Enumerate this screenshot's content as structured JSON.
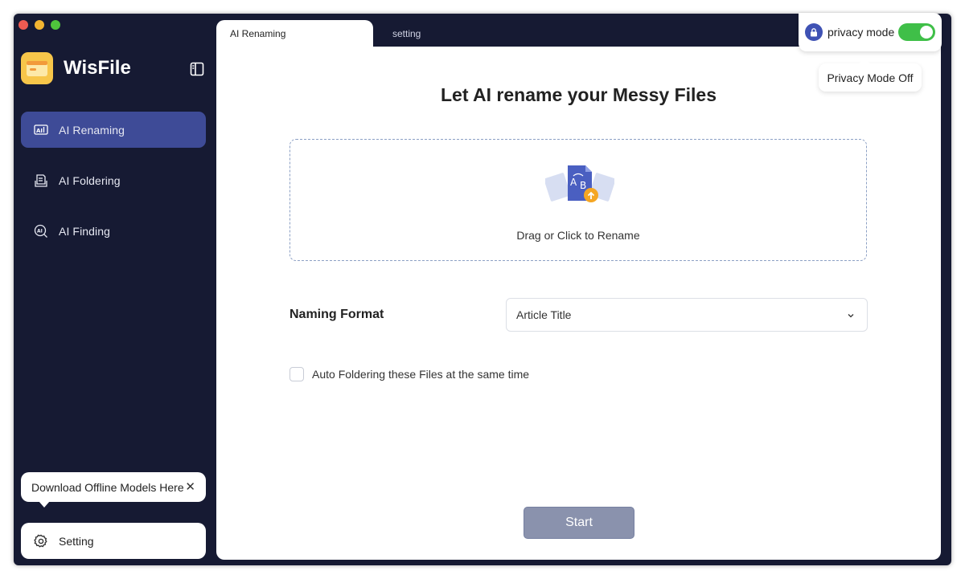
{
  "app": {
    "name": "WisFile"
  },
  "sidebar": {
    "items": [
      {
        "label": "AI Renaming",
        "icon": "ai-rename-icon",
        "active": true
      },
      {
        "label": "AI Foldering",
        "icon": "ai-folder-icon",
        "active": false
      },
      {
        "label": "AI Finding",
        "icon": "ai-search-icon",
        "active": false
      }
    ],
    "download_tip": "Download Offline Models Here",
    "setting_label": "Setting"
  },
  "tabs": [
    {
      "label": "AI Renaming",
      "active": true
    },
    {
      "label": "setting",
      "active": false
    }
  ],
  "privacy": {
    "label": "privacy mode",
    "tooltip": "Privacy Mode Off",
    "toggle_color": "#3fbf48"
  },
  "main": {
    "headline": "Let AI rename your Messy Files",
    "dropzone_text": "Drag or Click to Rename",
    "naming_label": "Naming Format",
    "naming_value": "Article Title",
    "auto_folder_label": "Auto Foldering these Files at the same time",
    "start_label": "Start"
  },
  "colors": {
    "sidebar_bg": "#161a33",
    "active_nav": "#3e4b97",
    "start_button": "#8a92ad"
  }
}
